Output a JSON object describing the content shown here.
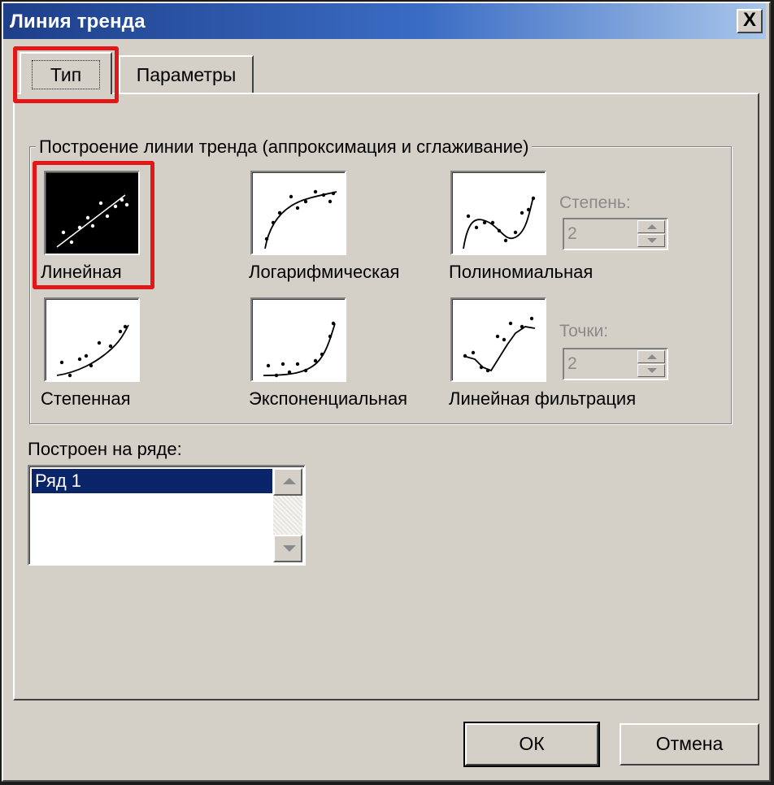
{
  "window": {
    "title": "Линия тренда",
    "close_symbol": "X"
  },
  "tabs": [
    {
      "label": "Тип",
      "active": true
    },
    {
      "label": "Параметры",
      "active": false
    }
  ],
  "trend_group": {
    "label": "Построение линии тренда (аппроксимация и сглаживание)",
    "types": [
      {
        "label": "Линейная",
        "selected": true
      },
      {
        "label": "Логарифмическая",
        "selected": false
      },
      {
        "label": "Полиномиальная",
        "selected": false
      },
      {
        "label": "Степенная",
        "selected": false
      },
      {
        "label": "Экспоненциальная",
        "selected": false
      },
      {
        "label": "Линейная фильтрация",
        "selected": false
      }
    ],
    "degree": {
      "label": "Степень:",
      "value": "2"
    },
    "points": {
      "label": "Точки:",
      "value": "2"
    }
  },
  "series": {
    "label": "Построен на ряде:",
    "items": [
      "Ряд 1"
    ]
  },
  "buttons": {
    "ok": "ОК",
    "cancel": "Отмена"
  }
}
